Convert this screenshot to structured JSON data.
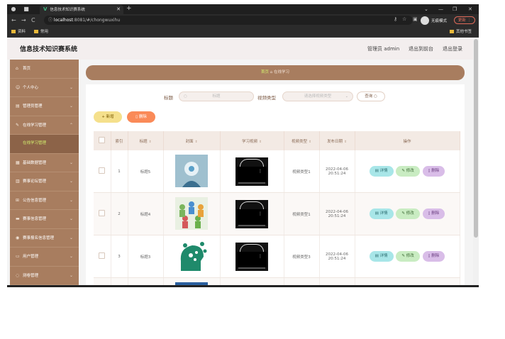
{
  "browser": {
    "tab_title": "信息技术知识赛系统",
    "url_host": "localhost",
    "url_rest": ":8081/#/chongwuxihu",
    "guest_label": "无痕模式",
    "update_label": "更新",
    "bookmarks": [
      "资料",
      "常用"
    ],
    "bookmark_right": "其他书签"
  },
  "header": {
    "site_title": "信息技术知识赛系统",
    "role_text": "管理员 admin",
    "back_link": "退出到前台",
    "logout_link": "退出登录"
  },
  "sidebar": {
    "items": [
      {
        "label": "首页",
        "icon": "home-icon"
      },
      {
        "label": "个人中心",
        "icon": "user-icon"
      },
      {
        "label": "管理员管理",
        "icon": "admin-icon"
      },
      {
        "label": "在线学习管理",
        "icon": "study-icon"
      },
      {
        "label": "在线学习管理",
        "icon": "",
        "sub": true
      },
      {
        "label": "基础数据管理",
        "icon": "data-icon"
      },
      {
        "label": "赛事论坛管理",
        "icon": "forum-icon"
      },
      {
        "label": "公告信息管理",
        "icon": "notice-icon"
      },
      {
        "label": "赛事信息管理",
        "icon": "event-icon"
      },
      {
        "label": "赛事报名信息管理",
        "icon": "signup-icon"
      },
      {
        "label": "用户管理",
        "icon": "users-icon"
      },
      {
        "label": "测卷管理",
        "icon": "exam-icon"
      }
    ]
  },
  "breadcrumb": {
    "home": "首页",
    "current": "在线学习"
  },
  "search": {
    "title_label": "标题",
    "title_placeholder": "标题",
    "type_label": "视频类型",
    "type_placeholder": "请选择视频类型",
    "query_button": "查询"
  },
  "actions": {
    "add": "新增",
    "delete": "删除"
  },
  "table": {
    "headers": [
      "",
      "索引",
      "标题",
      "封面",
      "学习视频",
      "视频类型",
      "发布日期",
      "操作"
    ],
    "row_actions": {
      "detail": "详情",
      "edit": "修改",
      "delete": "删除"
    },
    "rows": [
      {
        "index": "1",
        "title": "标题5",
        "type": "视频类型1",
        "date": "2022-04-06",
        "time": "20:51:24"
      },
      {
        "index": "2",
        "title": "标题4",
        "type": "视频类型1",
        "date": "2022-04-06",
        "time": "20:51:24"
      },
      {
        "index": "3",
        "title": "标题3",
        "type": "视频类型3",
        "date": "2022-04-06",
        "time": "20:51:24"
      }
    ]
  },
  "colors": {
    "accent_brown": "#a87d5f",
    "active_green": "#d3ef6e",
    "add_yellow": "#f5e08c",
    "delete_orange": "#fa8a58"
  }
}
